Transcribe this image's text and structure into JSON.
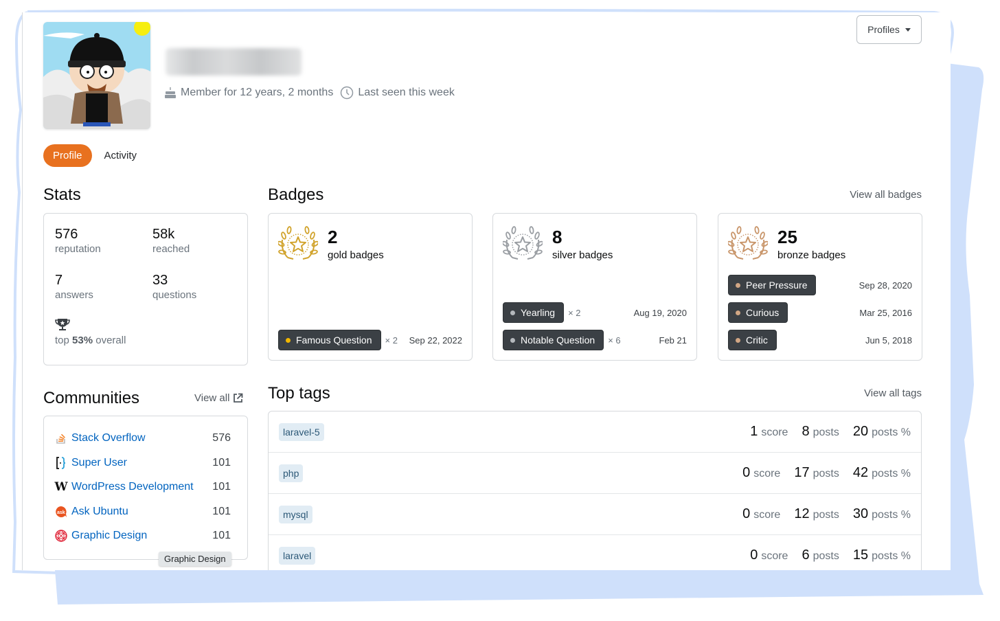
{
  "header": {
    "username_blurred": "Dong3000",
    "member_for": "Member for 12 years, 2 months",
    "last_seen": "Last seen this week",
    "profiles_button": "Profiles"
  },
  "tabs": [
    {
      "label": "Profile",
      "active": true
    },
    {
      "label": "Activity",
      "active": false
    }
  ],
  "stats": {
    "title": "Stats",
    "items": [
      {
        "value": "576",
        "label": "reputation"
      },
      {
        "value": "58k",
        "label": "reached"
      },
      {
        "value": "7",
        "label": "answers"
      },
      {
        "value": "33",
        "label": "questions"
      }
    ],
    "rank_prefix": "top",
    "rank_value": "53%",
    "rank_suffix": "overall"
  },
  "badges": {
    "title": "Badges",
    "view_all": "View all badges",
    "groups": [
      {
        "count": "2",
        "label": "gold badges",
        "color": "#d1a32c",
        "dot": "#f1b600",
        "items": [
          {
            "name": "Famous Question",
            "times": "× 2",
            "date": "Sep 22, 2022"
          }
        ]
      },
      {
        "count": "8",
        "label": "silver badges",
        "color": "#9a9ea3",
        "dot": "#b4b8bc",
        "items": [
          {
            "name": "Yearling",
            "times": "× 2",
            "date": "Aug 19, 2020"
          },
          {
            "name": "Notable Question",
            "times": "× 6",
            "date": "Feb 21"
          }
        ]
      },
      {
        "count": "25",
        "label": "bronze badges",
        "color": "#c9966b",
        "dot": "#d1a684",
        "items": [
          {
            "name": "Peer Pressure",
            "times": "",
            "date": "Sep 28, 2020"
          },
          {
            "name": "Curious",
            "times": "",
            "date": "Mar 25, 2016"
          },
          {
            "name": "Critic",
            "times": "",
            "date": "Jun 5, 2018"
          }
        ]
      }
    ]
  },
  "communities": {
    "title": "Communities",
    "view_all": "View all",
    "items": [
      {
        "name": "Stack Overflow",
        "rep": "576",
        "icon": "stack-overflow-icon"
      },
      {
        "name": "Super User",
        "rep": "101",
        "icon": "super-user-icon"
      },
      {
        "name": "WordPress Development",
        "rep": "101",
        "icon": "wordpress-icon"
      },
      {
        "name": "Ask Ubuntu",
        "rep": "101",
        "icon": "ask-ubuntu-icon"
      },
      {
        "name": "Graphic Design",
        "rep": "101",
        "icon": "graphic-design-icon"
      }
    ],
    "tooltip": "Graphic Design"
  },
  "top_tags": {
    "title": "Top tags",
    "view_all": "View all tags",
    "score_unit": "score",
    "posts_unit": "posts",
    "pct_unit": "posts %",
    "rows": [
      {
        "tag": "laravel-5",
        "score": "1",
        "posts": "8",
        "pct": "20"
      },
      {
        "tag": "php",
        "score": "0",
        "posts": "17",
        "pct": "42"
      },
      {
        "tag": "mysql",
        "score": "0",
        "posts": "12",
        "pct": "30"
      },
      {
        "tag": "laravel",
        "score": "0",
        "posts": "6",
        "pct": "15"
      }
    ]
  },
  "colors": {
    "accent": "#e8711f",
    "link": "#0063bf",
    "frame": "#cfe0fb"
  }
}
